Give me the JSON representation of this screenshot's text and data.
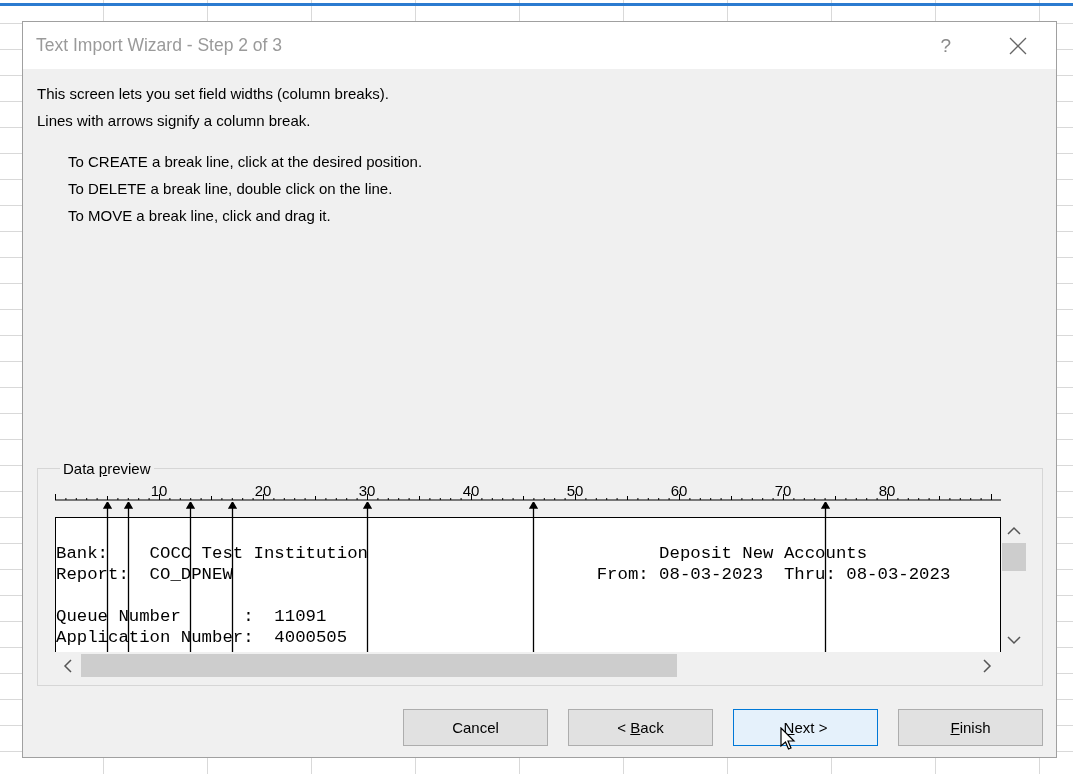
{
  "window": {
    "title": "Text Import Wizard - Step 2 of 3",
    "help": "?"
  },
  "intro": [
    "This screen lets you set field widths (column breaks).",
    "Lines with arrows signify a column break."
  ],
  "instructions": [
    "To CREATE a break line, click at the desired position.",
    "To DELETE a break line, double click on the line.",
    "To MOVE a break line, click and drag it."
  ],
  "preview": {
    "label": {
      "pre": "Data ",
      "key": "p",
      "post": "review"
    },
    "ruler_labels": [
      "10",
      "20",
      "30",
      "40",
      "50",
      "60",
      "70",
      "80"
    ],
    "breaks": [
      {
        "level": 0.0549
      },
      {
        "level": 0.0769
      },
      {
        "level": 0.1429
      },
      {
        "level": 0.1868
      },
      {
        "level": 0.3297
      },
      {
        "level": 0.5055
      },
      {
        "level": 0.8132
      }
    ],
    "lines": [
      {
        "text": "Bank:    COCC Test Institution                            Deposit New Accounts",
        "blank_before": true
      },
      {
        "text": "Report:  CO_DPNEW                                   From: 08-03-2023  Thru: 08-03-2023",
        "blank_before": false
      },
      {
        "text": "Queue Number      :  11091",
        "blank_before": true
      },
      {
        "text": "Application Number:  4000505",
        "blank_before": false
      }
    ]
  },
  "buttons": [
    {
      "text": "Cancel",
      "focused": false
    },
    {
      "pre": "< ",
      "key": "B",
      "post": "ack",
      "focused": false
    },
    {
      "key": "N",
      "post": "ext >",
      "focused": true
    },
    {
      "key": "F",
      "post": "inish",
      "focused": false
    }
  ]
}
